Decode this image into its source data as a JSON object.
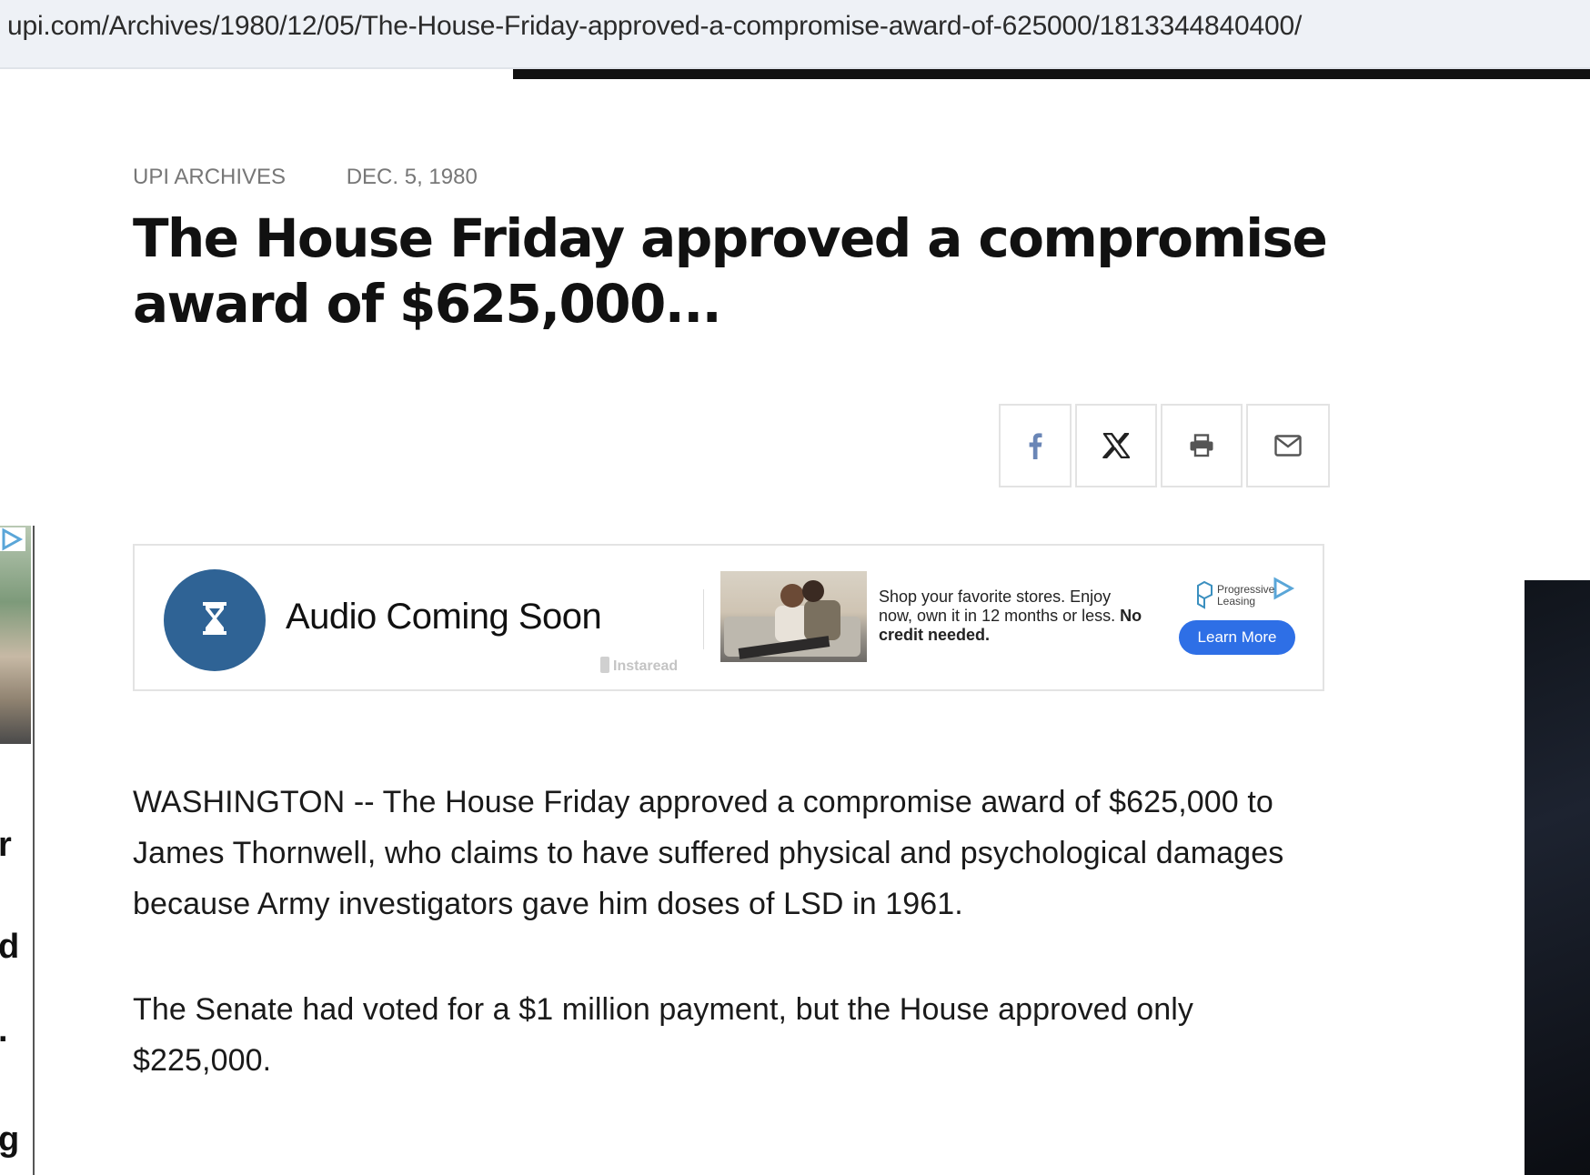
{
  "browser": {
    "url": "upi.com/Archives/1980/12/05/The-House-Friday-approved-a-compromise-award-of-625000/1813344840400/"
  },
  "article": {
    "section": "UPI ARCHIVES",
    "date": "DEC. 5, 1980",
    "headline": "The House Friday approved a compromise award of $625,000...",
    "paragraphs": [
      "WASHINGTON -- The House Friday approved a compromise award of $625,000 to James Thornwell, who claims to have suffered physical and psychological damages because Army investigators gave him doses of LSD in 1961.",
      "The Senate had voted for a $1 million payment, but the House approved only $225,000."
    ]
  },
  "share_buttons": [
    {
      "name": "facebook-icon"
    },
    {
      "name": "x-icon"
    },
    {
      "name": "print-icon"
    },
    {
      "name": "email-icon"
    }
  ],
  "audio_player": {
    "title": "Audio Coming Soon",
    "branding": "Instaread",
    "icon": "hourglass-icon",
    "accent_color": "#2f6395"
  },
  "advertisement": {
    "text_regular": "Shop your favorite stores. Enjoy now, own it in 12 months or less.",
    "text_bold": "No credit needed.",
    "brand_line1": "Progressive",
    "brand_line2": "Leasing",
    "cta": "Learn More",
    "cta_color": "#2e6fe6"
  },
  "left_ad_fragments": [
    "r",
    "d",
    ".",
    "g"
  ]
}
